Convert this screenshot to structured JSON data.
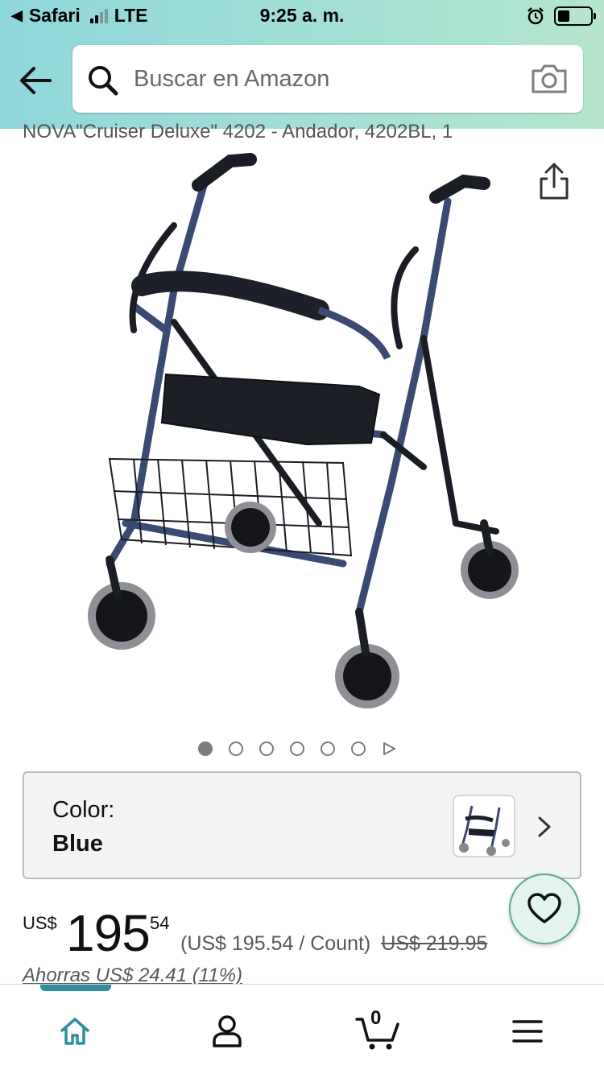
{
  "status_bar": {
    "carrier": "Safari",
    "network": "LTE",
    "time": "9:25 a. m."
  },
  "search": {
    "placeholder": "Buscar en Amazon"
  },
  "product": {
    "title": "NOVA\"Cruiser Deluxe\" 4202 - Andador, 4202BL, 1",
    "image_icon": "rollator-walker",
    "pager": {
      "total_images": 6,
      "active_index": 1
    }
  },
  "color_option": {
    "label": "Color:",
    "value": "Blue"
  },
  "price": {
    "currency": "US$",
    "whole": "195",
    "fraction": "54",
    "unit_price": "(US$ 195.54 / Count)",
    "list_price": "US$ 219.95",
    "savings": "Ahorras US$ 24.41 (11%)"
  },
  "bottom_nav": {
    "cart_count": "0",
    "items": [
      "home-icon",
      "account-icon",
      "cart-icon",
      "menu-icon"
    ]
  },
  "colors": {
    "header_start": "#8fd6dc",
    "header_end": "#b5e6cd",
    "accent": "#2f8f9d",
    "fav_bg": "#e3f4ef"
  }
}
